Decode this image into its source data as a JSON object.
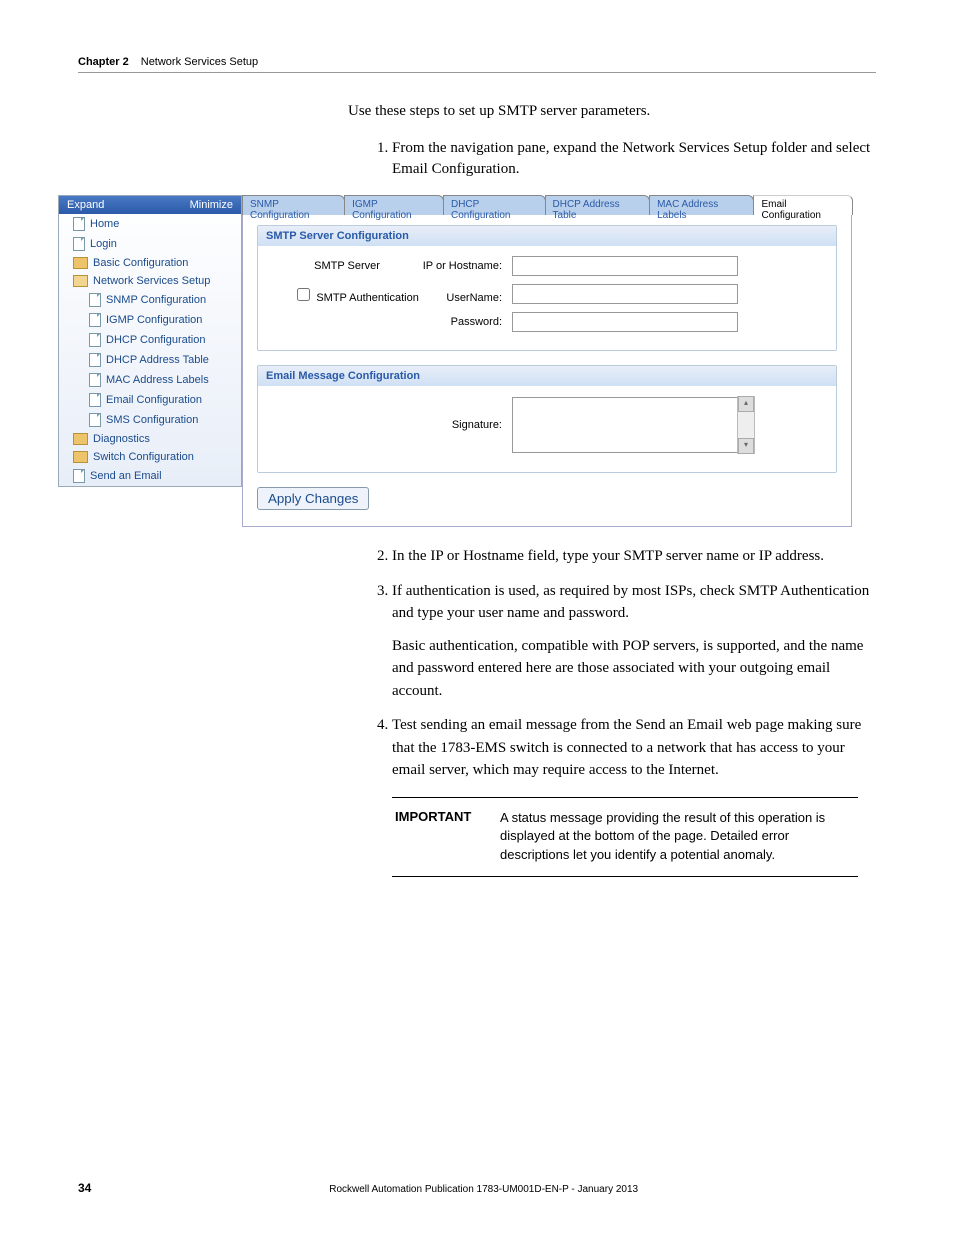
{
  "header": {
    "chapter": "Chapter 2",
    "title": "Network Services Setup"
  },
  "intro": "Use these steps to set up SMTP server parameters.",
  "step1": "From the navigation pane, expand the Network Services Setup folder and select Email Configuration.",
  "nav": {
    "expand": "Expand",
    "minimize": "Minimize",
    "items": [
      "Home",
      "Login",
      "Basic Configuration",
      "Network Services Setup",
      "SNMP Configuration",
      "IGMP Configuration",
      "DHCP Configuration",
      "DHCP Address Table",
      "MAC Address Labels",
      "Email Configuration",
      "SMS Configuration",
      "Diagnostics",
      "Switch Configuration",
      "Send an Email"
    ]
  },
  "tabs": [
    "SNMP Configuration",
    "IGMP Configuration",
    "DHCP Configuration",
    "DHCP Address Table",
    "MAC Address Labels",
    "Email Configuration"
  ],
  "box1": {
    "title": "SMTP Server Configuration",
    "smtp": "SMTP Server",
    "ip": "IP or Hostname:",
    "auth": "SMTP Authentication",
    "user": "UserName:",
    "pass": "Password:"
  },
  "box2": {
    "title": "Email Message Configuration",
    "sig": "Signature:"
  },
  "apply": "Apply Changes",
  "step2": "In the IP or Hostname field, type your SMTP server name or IP address.",
  "step3": "If authentication is used, as required by most ISPs, check SMTP Authentication and type your user name and password.",
  "step3b": "Basic authentication, compatible with POP servers, is supported, and the name and password entered here are those associated with your outgoing email account.",
  "step4": "Test sending an email message from the Send an Email web page making sure that the 1783-EMS switch is connected to a network that has access to your email server, which may require access to the Internet.",
  "imp": {
    "label": "IMPORTANT",
    "text": "A status message providing the result of this operation is displayed at the bottom of the page. Detailed error descriptions let you identify a potential anomaly."
  },
  "footer": {
    "page": "34",
    "pub": "Rockwell Automation Publication 1783-UM001D-EN-P - January 2013"
  }
}
